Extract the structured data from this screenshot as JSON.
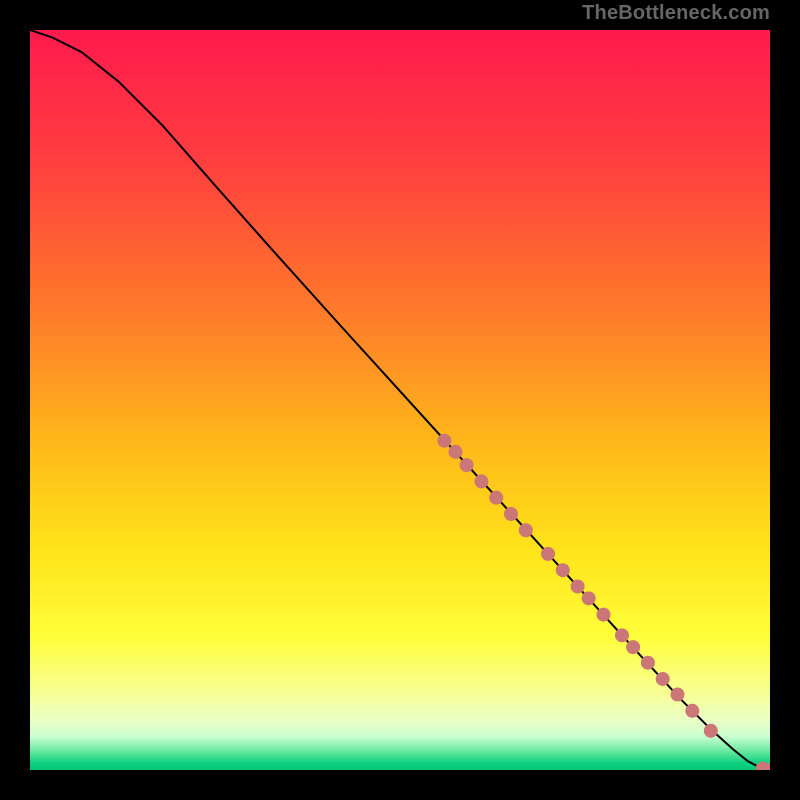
{
  "attribution": "TheBottleneck.com",
  "colors": {
    "page_bg": "#000000",
    "attribution_text": "#666666",
    "curve": "#000000",
    "marker_fill": "#cc7777",
    "gradient_stops": [
      {
        "offset": 0.0,
        "color": "#ff1a4d"
      },
      {
        "offset": 0.18,
        "color": "#ff3f3f"
      },
      {
        "offset": 0.38,
        "color": "#ff7a2a"
      },
      {
        "offset": 0.55,
        "color": "#ffb51a"
      },
      {
        "offset": 0.7,
        "color": "#ffe31a"
      },
      {
        "offset": 0.82,
        "color": "#fffe3a"
      },
      {
        "offset": 0.9,
        "color": "#f6ff9a"
      },
      {
        "offset": 0.935,
        "color": "#e8ffc6"
      },
      {
        "offset": 0.955,
        "color": "#c8ffd0"
      },
      {
        "offset": 0.975,
        "color": "#66e8a0"
      },
      {
        "offset": 0.99,
        "color": "#10d080"
      },
      {
        "offset": 1.0,
        "color": "#00c878"
      }
    ]
  },
  "chart_data": {
    "type": "line",
    "title": "",
    "xlabel": "",
    "ylabel": "",
    "xlim": [
      0,
      1
    ],
    "ylim": [
      0,
      1
    ],
    "grid": false,
    "legend": false,
    "series": [
      {
        "name": "curve",
        "x": [
          0.0,
          0.03,
          0.07,
          0.12,
          0.18,
          0.25,
          0.33,
          0.42,
          0.52,
          0.62,
          0.72,
          0.82,
          0.88,
          0.92,
          0.95,
          0.97,
          0.985,
          1.0
        ],
        "y": [
          1.0,
          0.99,
          0.97,
          0.93,
          0.87,
          0.79,
          0.7,
          0.6,
          0.49,
          0.38,
          0.27,
          0.16,
          0.095,
          0.055,
          0.028,
          0.012,
          0.004,
          0.0
        ]
      }
    ],
    "markers": {
      "name": "highlighted-points",
      "x": [
        0.56,
        0.575,
        0.59,
        0.61,
        0.63,
        0.65,
        0.67,
        0.7,
        0.72,
        0.74,
        0.755,
        0.775,
        0.8,
        0.815,
        0.835,
        0.855,
        0.875,
        0.895,
        0.92,
        0.99,
        1.0
      ],
      "y": [
        0.445,
        0.43,
        0.412,
        0.39,
        0.368,
        0.346,
        0.324,
        0.292,
        0.27,
        0.248,
        0.232,
        0.21,
        0.182,
        0.166,
        0.145,
        0.123,
        0.102,
        0.08,
        0.053,
        0.002,
        0.0
      ]
    }
  }
}
